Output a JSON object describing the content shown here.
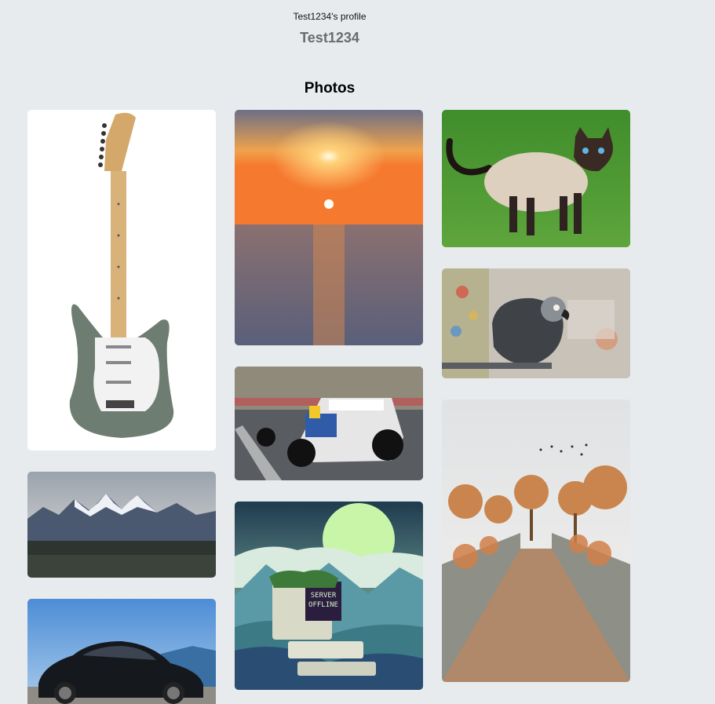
{
  "header": {
    "caption": "Test1234's profile",
    "username": "Test1234"
  },
  "photos_section": {
    "title": "Photos"
  },
  "photos": [
    {
      "name": "guitar-photo",
      "subject": "Electric guitar"
    },
    {
      "name": "sunset-photo",
      "subject": "Sunset over sea"
    },
    {
      "name": "cat-photo",
      "subject": "Siamese cat on grass"
    },
    {
      "name": "parrot-photo",
      "subject": "Grey parrot"
    },
    {
      "name": "racecar-photo",
      "subject": "Formula 1 race car"
    },
    {
      "name": "mountains-photo",
      "subject": "Snowy mountain range"
    },
    {
      "name": "server-offline-photo",
      "subject": "Overgrown computer illustration",
      "screen_text": [
        "SERVER",
        "OFFLINE"
      ]
    },
    {
      "name": "garden-path-photo",
      "subject": "Garden path with planters"
    },
    {
      "name": "car-photo",
      "subject": "Black Mercedes car"
    }
  ],
  "colors": {
    "page_background": "#e8ebee",
    "username_color": "#6b6b6b"
  }
}
